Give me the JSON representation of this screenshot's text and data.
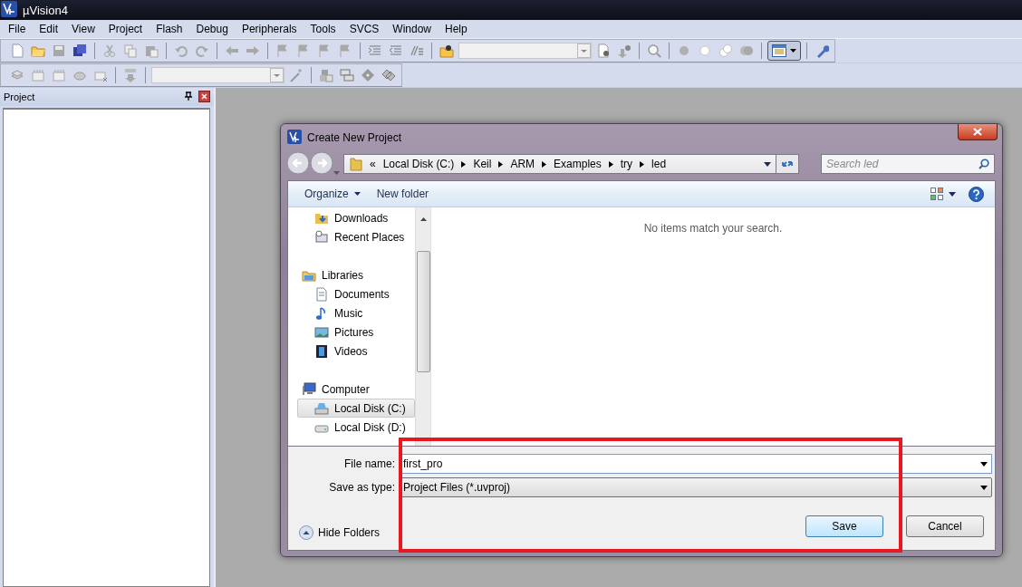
{
  "window": {
    "title": "µVision4"
  },
  "menu": [
    "File",
    "Edit",
    "View",
    "Project",
    "Flash",
    "Debug",
    "Peripherals",
    "Tools",
    "SVCS",
    "Window",
    "Help"
  ],
  "project_panel": {
    "title": "Project"
  },
  "dialog": {
    "title": "Create New Project",
    "address": {
      "overflow_mark": "«",
      "path": [
        "Local Disk (C:)",
        "Keil",
        "ARM",
        "Examples",
        "try",
        "led"
      ]
    },
    "search": {
      "placeholder": "Search led"
    },
    "commands": [
      {
        "label": "Organize",
        "has_menu": true
      },
      {
        "label": "New folder",
        "has_menu": false
      }
    ],
    "nav": {
      "favorites": [
        {
          "label": "Downloads",
          "selected": false
        },
        {
          "label": "Recent Places",
          "selected": false
        }
      ],
      "groups": [
        {
          "label": "Libraries",
          "children": [
            {
              "label": "Documents",
              "selected": false
            },
            {
              "label": "Music",
              "selected": false
            },
            {
              "label": "Pictures",
              "selected": false
            },
            {
              "label": "Videos",
              "selected": false
            }
          ]
        },
        {
          "label": "Computer",
          "children": [
            {
              "label": "Local Disk (C:)",
              "selected": true
            },
            {
              "label": "Local Disk (D:)",
              "selected": false
            }
          ]
        }
      ]
    },
    "empty_message": "No items match your search.",
    "fields": [
      {
        "label": "File name:",
        "value": "first_pro",
        "editable": true
      },
      {
        "label": "Save as type:",
        "value": "Project Files (*.uvproj)",
        "editable": false
      }
    ],
    "hide_folders": "Hide Folders",
    "buttons": [
      {
        "label": "Save",
        "default": true
      },
      {
        "label": "Cancel",
        "default": false
      }
    ]
  }
}
